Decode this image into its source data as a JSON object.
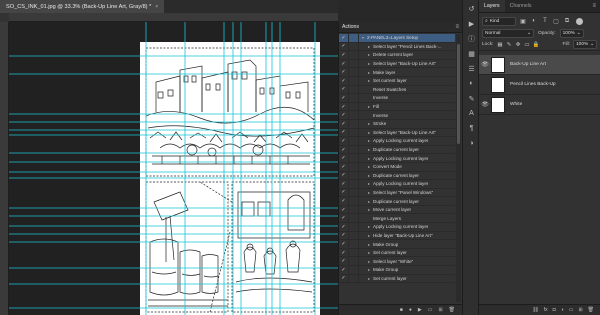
{
  "document": {
    "tab_title": "SO_CS_INK_01.jpg @ 33.3% (Back-Up Line Art, Gray/8) *",
    "close_glyph": "×"
  },
  "colors": {
    "guide": "#18c4d6",
    "selection": "#3d5d82",
    "panel_bg": "#323232"
  },
  "actions_panel": {
    "title": "Actions",
    "menu_icon": "panel-menu-icon",
    "check_glyph": "✓",
    "expand_glyph": "▸",
    "collapse_glyph": "▾",
    "items": [
      {
        "label": "2-PANEL3=Layers Setup",
        "expanded": true,
        "selected": true
      },
      {
        "label": "Select layer \"Pencil Lines Back-..."
      },
      {
        "label": "Delete current layer"
      },
      {
        "label": "Select layer \"Back-Up Line Art\""
      },
      {
        "label": "Make layer"
      },
      {
        "label": "Set current layer"
      },
      {
        "label": "Reset Swatches",
        "leaf": true
      },
      {
        "label": "Inverse",
        "leaf": true
      },
      {
        "label": "Fill"
      },
      {
        "label": "Inverse",
        "leaf": true
      },
      {
        "label": "Stroke"
      },
      {
        "label": "Select layer \"Back-Up Line Art\""
      },
      {
        "label": "Apply Locking current layer"
      },
      {
        "label": "Duplicate current layer"
      },
      {
        "label": "Apply Locking current layer"
      },
      {
        "label": "Convert Mode"
      },
      {
        "label": "Duplicate current layer"
      },
      {
        "label": "Apply Locking current layer"
      },
      {
        "label": "Select layer \"Panel Windows\""
      },
      {
        "label": "Duplicate current layer"
      },
      {
        "label": "Move current layer"
      },
      {
        "label": "Merge Layers",
        "leaf": true
      },
      {
        "label": "Apply Locking current layer"
      },
      {
        "label": "Hide layer \"Back-Up Line Art\""
      },
      {
        "label": "Make Group"
      },
      {
        "label": "Set current layer"
      },
      {
        "label": "Select layer \"White\""
      },
      {
        "label": "Make Group"
      },
      {
        "label": "Set current layer"
      }
    ],
    "footer_icons": [
      "stop-icon",
      "record-icon",
      "play-icon",
      "folder-icon",
      "new-action-icon",
      "delete-icon"
    ],
    "footer_glyphs": [
      "■",
      "●",
      "▶",
      "▭",
      "⊞",
      "🗑"
    ]
  },
  "icon_strip": {
    "icons": [
      "history-icon",
      "actions-icon",
      "info-icon",
      "swatches-icon",
      "properties-icon",
      "color-icon",
      "brushes-icon",
      "character-icon",
      "paragraph-icon",
      "adjustments-icon"
    ],
    "glyphs": [
      "↺",
      "▶",
      "ⓘ",
      "▦",
      "☰",
      "◐",
      "✎",
      "A",
      "¶",
      "◑"
    ]
  },
  "layers_panel": {
    "tabs": [
      {
        "label": "Layers",
        "active": true
      },
      {
        "label": "Channels",
        "active": false
      }
    ],
    "menu_icon": "panel-menu-icon",
    "filter": {
      "kind_label": "Kind",
      "search_glyph": "⌕",
      "icon_names": [
        "pixel-filter-icon",
        "adjustment-filter-icon",
        "type-filter-icon",
        "shape-filter-icon",
        "smart-object-filter-icon"
      ],
      "icon_glyphs": [
        "▣",
        "◐",
        "T",
        "▢",
        "⧉"
      ]
    },
    "blend_mode": "Normal",
    "opacity_label": "Opacity:",
    "opacity_value": "100%",
    "lock_label": "Lock:",
    "lock_icons": [
      "lock-transparent-icon",
      "lock-paint-icon",
      "lock-move-icon",
      "lock-artboard-icon",
      "lock-all-icon"
    ],
    "lock_glyphs": [
      "▦",
      "✎",
      "✥",
      "▭",
      "🔒"
    ],
    "fill_label": "Fill:",
    "fill_value": "100%",
    "layers": [
      {
        "name": "Back-Up Line Art",
        "visible": true,
        "selected": true
      },
      {
        "name": "Pencil Lines Back-Up",
        "visible": false,
        "selected": false
      },
      {
        "name": "White",
        "visible": true,
        "selected": false
      }
    ],
    "eye_glyph": "👁",
    "footer_icons": [
      "link-layers-icon",
      "fx-icon",
      "mask-icon",
      "adjustment-layer-icon",
      "new-group-icon",
      "new-layer-icon",
      "delete-layer-icon"
    ],
    "footer_glyphs": [
      "⛓",
      "fx",
      "◘",
      "◑",
      "▭",
      "⊞",
      "🗑"
    ]
  }
}
